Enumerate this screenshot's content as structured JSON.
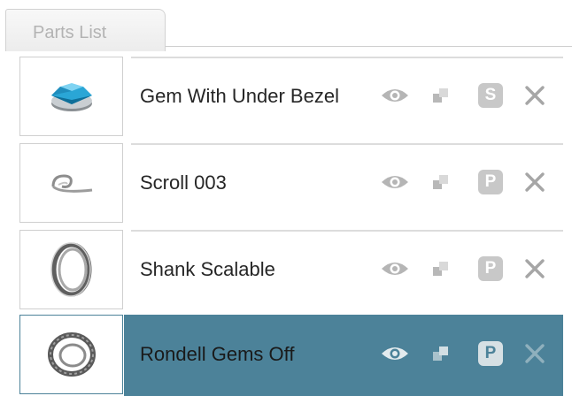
{
  "panel": {
    "tab_label": "Parts List"
  },
  "parts": [
    {
      "name": "Gem With Under Bezel",
      "thumbnail_icon": "gem-bezel-thumbnail",
      "badge": "S",
      "selected": false
    },
    {
      "name": "Scroll 003",
      "thumbnail_icon": "scroll-thumbnail",
      "badge": "P",
      "selected": false
    },
    {
      "name": "Shank Scalable",
      "thumbnail_icon": "ring-shank-thumbnail",
      "badge": "P",
      "selected": false
    },
    {
      "name": "Rondell Gems Off",
      "thumbnail_icon": "rondell-thumbnail",
      "badge": "P",
      "selected": true
    }
  ],
  "row_actions": {
    "visibility_icon": "eye-icon",
    "layer_icon": "layer-icon",
    "remove_icon": "close-icon"
  },
  "colors": {
    "selection": "#4c8299",
    "icon_gray": "#b5b5b5",
    "badge_gray": "#c8c8c8"
  }
}
